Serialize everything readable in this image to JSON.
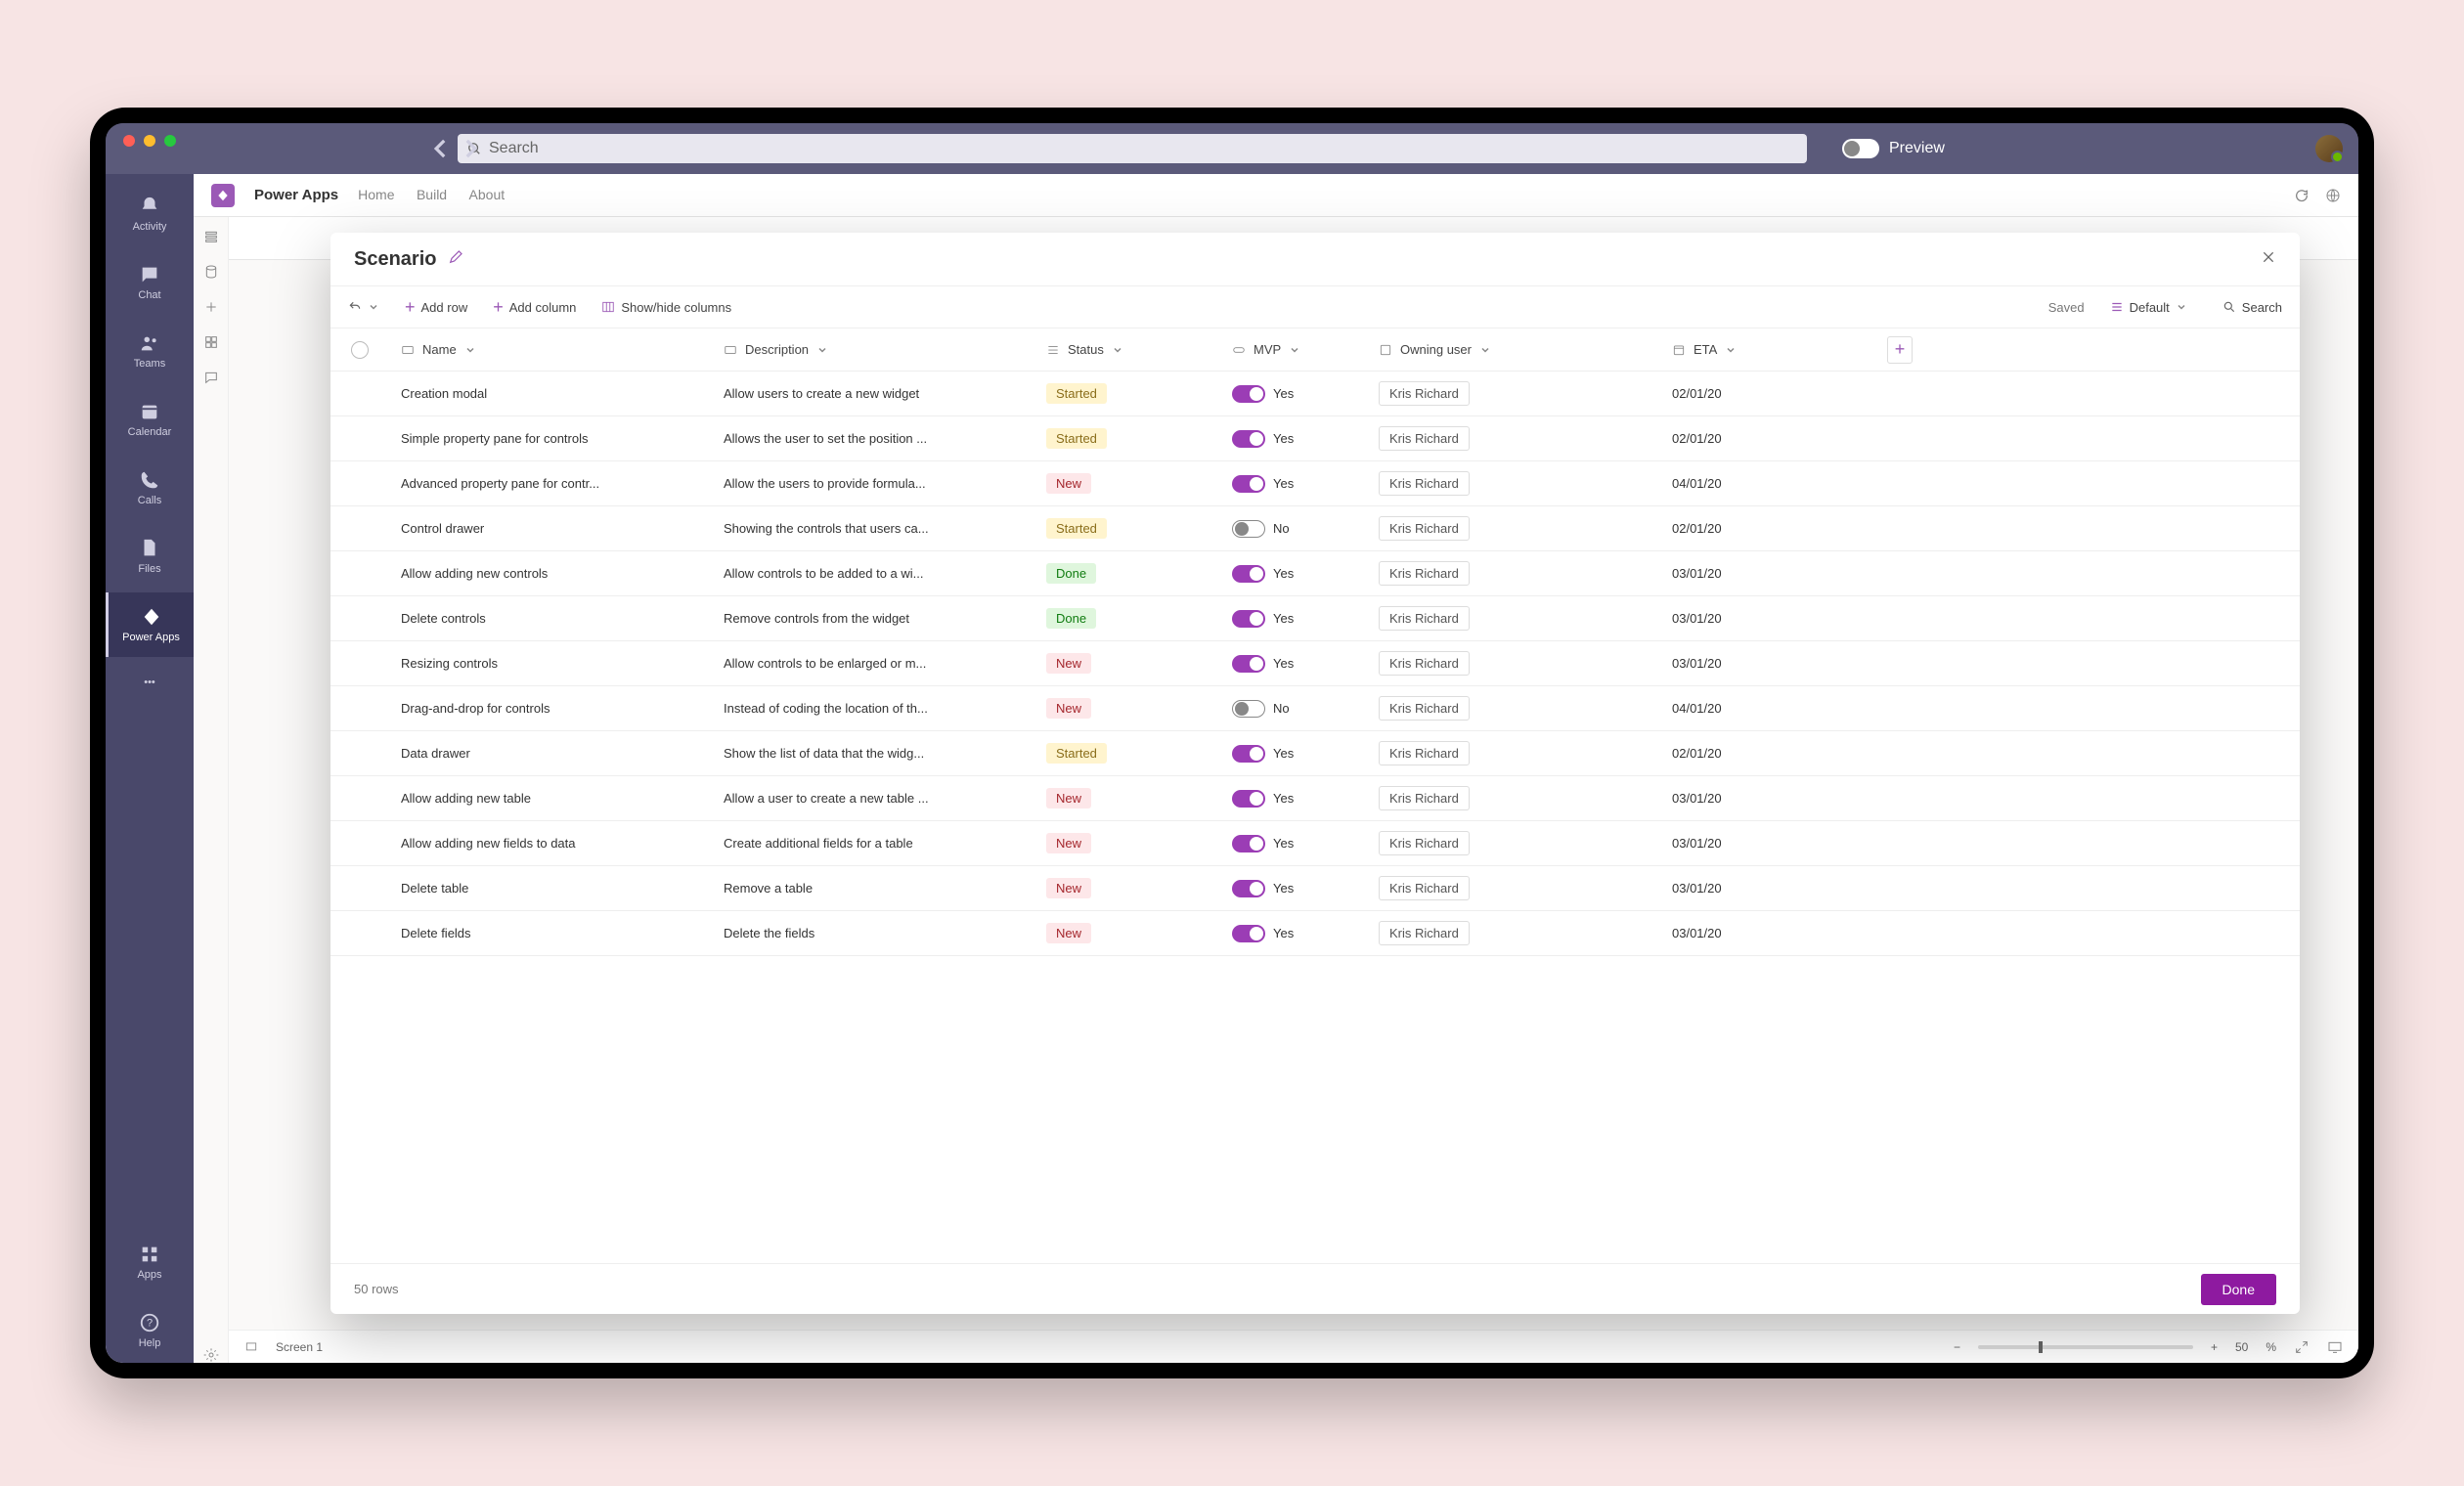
{
  "topbar": {
    "search_placeholder": "Search",
    "preview_label": "Preview"
  },
  "rail": {
    "items": [
      {
        "label": "Activity"
      },
      {
        "label": "Chat"
      },
      {
        "label": "Teams"
      },
      {
        "label": "Calendar"
      },
      {
        "label": "Calls"
      },
      {
        "label": "Files"
      },
      {
        "label": "Power Apps"
      }
    ],
    "bottom": [
      {
        "label": "Apps"
      },
      {
        "label": "Help"
      }
    ]
  },
  "app": {
    "title": "Power Apps",
    "nav": [
      "Home",
      "Build",
      "About"
    ]
  },
  "modal": {
    "title": "Scenario",
    "toolbar": {
      "add_row": "Add row",
      "add_column": "Add column",
      "show_hide": "Show/hide columns",
      "saved": "Saved",
      "view": "Default",
      "search": "Search"
    },
    "columns": {
      "name": "Name",
      "description": "Description",
      "status": "Status",
      "mvp": "MVP",
      "owning_user": "Owning user",
      "eta": "ETA"
    },
    "rows": [
      {
        "name": "Creation modal",
        "desc": "Allow users to create a new widget",
        "status": "Started",
        "mvp": true,
        "user": "Kris Richard",
        "eta": "02/01/20"
      },
      {
        "name": "Simple property pane for controls",
        "desc": "Allows the user to set the position ...",
        "status": "Started",
        "mvp": true,
        "user": "Kris Richard",
        "eta": "02/01/20"
      },
      {
        "name": "Advanced property pane for contr...",
        "desc": "Allow the users to provide formula...",
        "status": "New",
        "mvp": true,
        "user": "Kris Richard",
        "eta": "04/01/20"
      },
      {
        "name": "Control drawer",
        "desc": "Showing the controls that users ca...",
        "status": "Started",
        "mvp": false,
        "user": "Kris Richard",
        "eta": "02/01/20"
      },
      {
        "name": "Allow adding new controls",
        "desc": "Allow controls to be added to a wi...",
        "status": "Done",
        "mvp": true,
        "user": "Kris Richard",
        "eta": "03/01/20"
      },
      {
        "name": "Delete controls",
        "desc": "Remove controls from the widget",
        "status": "Done",
        "mvp": true,
        "user": "Kris Richard",
        "eta": "03/01/20"
      },
      {
        "name": "Resizing controls",
        "desc": "Allow controls to be enlarged or m...",
        "status": "New",
        "mvp": true,
        "user": "Kris Richard",
        "eta": "03/01/20"
      },
      {
        "name": "Drag-and-drop for controls",
        "desc": "Instead of coding the location of th...",
        "status": "New",
        "mvp": false,
        "user": "Kris Richard",
        "eta": "04/01/20"
      },
      {
        "name": "Data drawer",
        "desc": "Show the list of data that the widg...",
        "status": "Started",
        "mvp": true,
        "user": "Kris Richard",
        "eta": "02/01/20"
      },
      {
        "name": "Allow adding new table",
        "desc": "Allow a user to create a new table ...",
        "status": "New",
        "mvp": true,
        "user": "Kris Richard",
        "eta": "03/01/20"
      },
      {
        "name": "Allow adding new fields to data",
        "desc": "Create additional fields for a table",
        "status": "New",
        "mvp": true,
        "user": "Kris Richard",
        "eta": "03/01/20"
      },
      {
        "name": "Delete table",
        "desc": "Remove a table",
        "status": "New",
        "mvp": true,
        "user": "Kris Richard",
        "eta": "03/01/20"
      },
      {
        "name": "Delete fields",
        "desc": "Delete the fields",
        "status": "New",
        "mvp": true,
        "user": "Kris Richard",
        "eta": "03/01/20"
      }
    ],
    "row_count": "50",
    "rows_label": "rows",
    "done": "Done"
  },
  "statusbar": {
    "screen": "Screen 1",
    "zoom": "50",
    "zoom_unit": "%"
  },
  "mvp_labels": {
    "yes": "Yes",
    "no": "No"
  }
}
